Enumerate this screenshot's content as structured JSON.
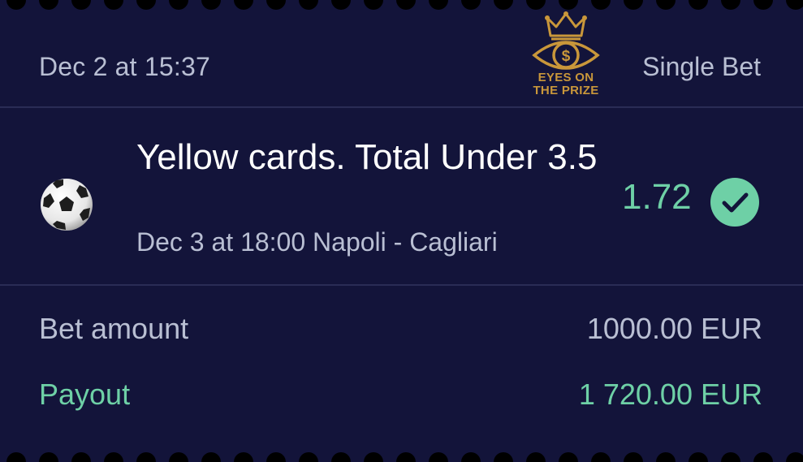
{
  "header": {
    "date": "Dec 2 at 15:37",
    "bet_type": "Single Bet",
    "logo": {
      "line1": "EYES ON",
      "line2": "THE PRIZE",
      "icon": "crown-eye-dollar-icon"
    }
  },
  "selection": {
    "sport_icon": "soccer-ball-icon",
    "market": "Yellow cards. Total Under 3.5",
    "event": "Dec 3 at 18:00 Napoli - Cagliari",
    "odds": "1.72",
    "status_icon": "check-circle-icon"
  },
  "summary": {
    "bet_amount_label": "Bet amount",
    "bet_amount_value": "1000.00 EUR",
    "payout_label": "Payout",
    "payout_value": "1 720.00 EUR"
  },
  "colors": {
    "background": "#13143a",
    "accent_green": "#6ed0a6",
    "muted_text": "#b9bfd3",
    "logo_gold": "#c9973a"
  }
}
